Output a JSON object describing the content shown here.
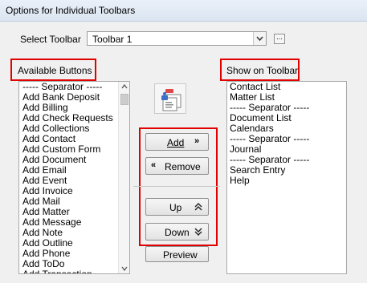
{
  "header": {
    "title": "Options for Individual Toolbars"
  },
  "toolbar_select": {
    "label": "Select Toolbar",
    "value": "Toolbar 1",
    "browse_label": "..."
  },
  "available": {
    "heading": "Available Buttons",
    "items": [
      "----- Separator -----",
      "Add Bank Deposit",
      "Add Billing",
      "Add Check Requests",
      "Add Collections",
      "Add Contact",
      "Add Custom Form",
      "Add Document",
      "Add Email",
      "Add Event",
      "Add Invoice",
      "Add Mail",
      "Add Matter",
      "Add Message",
      "Add Note",
      "Add Outline",
      "Add Phone",
      "Add ToDo",
      "Add Transaction"
    ]
  },
  "show": {
    "heading": "Show on Toolbar",
    "items": [
      "Contact List",
      "Matter List",
      "----- Separator -----",
      "Document List",
      "Calendars",
      "----- Separator -----",
      "Journal",
      "----- Separator -----",
      "Search Entry",
      "Help"
    ]
  },
  "buttons": {
    "add": "Add",
    "remove": "Remove",
    "up": "Up",
    "down": "Down",
    "preview": "Preview"
  },
  "accent_red": "#e00000"
}
